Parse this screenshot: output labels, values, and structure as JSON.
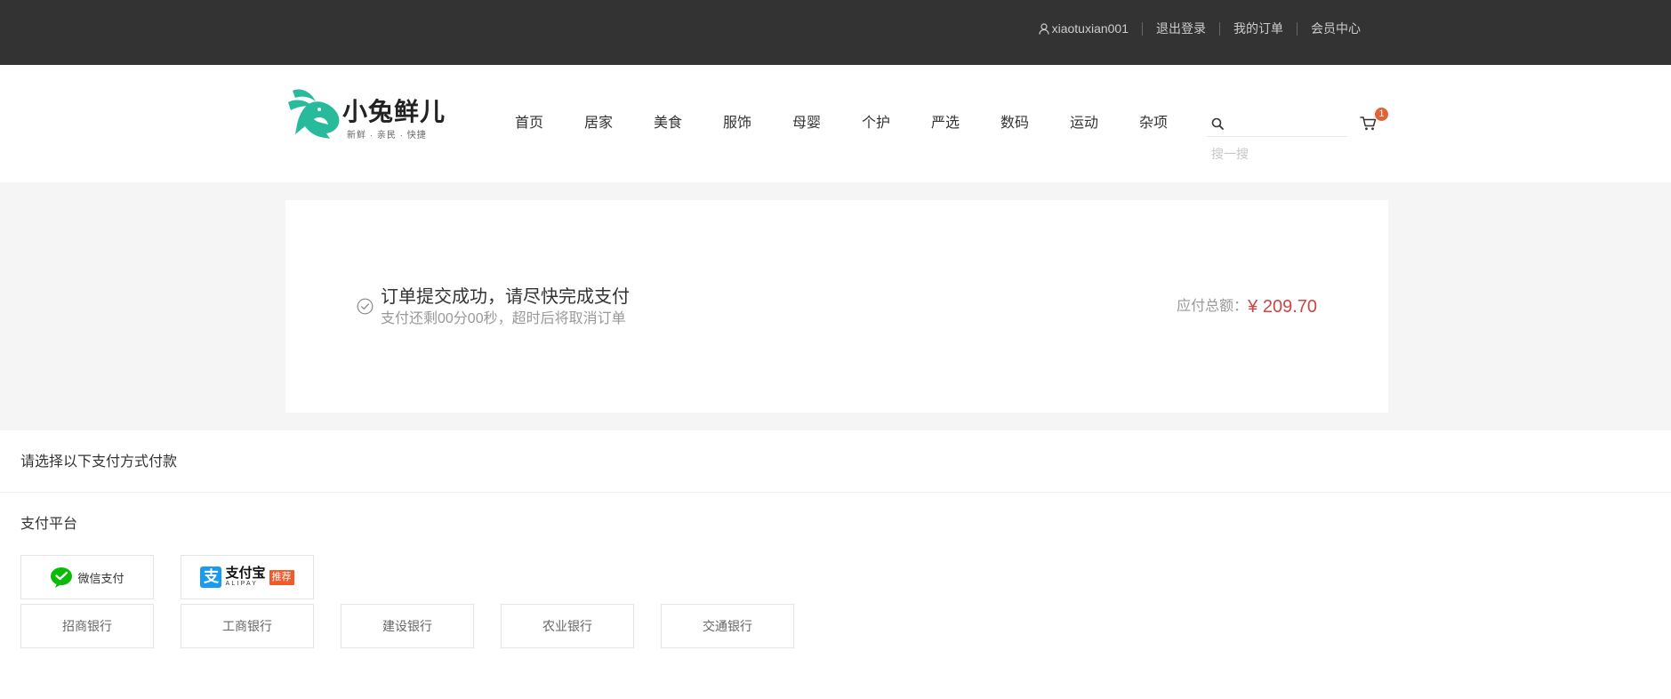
{
  "topbar": {
    "username": "xiaotuxian001",
    "links": [
      "退出登录",
      "我的订单",
      "会员中心"
    ]
  },
  "header": {
    "logo": {
      "name": "小兔鲜儿",
      "slogan": "新鲜 · 亲民 · 快捷"
    },
    "nav": [
      "首页",
      "居家",
      "美食",
      "服饰",
      "母婴",
      "个护",
      "严选",
      "数码",
      "运动",
      "杂项"
    ],
    "search": {
      "placeholder": "搜一搜"
    },
    "cart": {
      "count": "1"
    }
  },
  "order": {
    "title": "订单提交成功，请尽快完成支付",
    "countdown_text": "支付还剩00分00秒，超时后将取消订单",
    "total_label": "应付总额：",
    "total_amount": "¥ 209.70"
  },
  "payment": {
    "heading": "请选择以下支付方式付款",
    "platform_heading": "支付平台",
    "platforms": [
      {
        "label": "微信支付",
        "icon": "wechat-pay-icon"
      },
      {
        "label": "支付宝",
        "sub": "ALIPAY",
        "badge": "推荐",
        "icon": "alipay-icon",
        "icon_glyph": "支"
      }
    ],
    "banks": [
      "招商银行",
      "工商银行",
      "建设银行",
      "农业银行",
      "交通银行"
    ]
  },
  "icons": {
    "user": "user-icon",
    "search": "search-icon",
    "cart": "cart-icon",
    "success": "check-circle-icon",
    "logo": "rabbit-logo-icon"
  },
  "colors": {
    "topbar_bg": "#333333",
    "brand": "#27ba9b",
    "price": "#cf4444",
    "badge": "#e26237",
    "wechat": "#09bb07",
    "alipay": "#1a9bef",
    "recommend": "#f05b2c"
  }
}
